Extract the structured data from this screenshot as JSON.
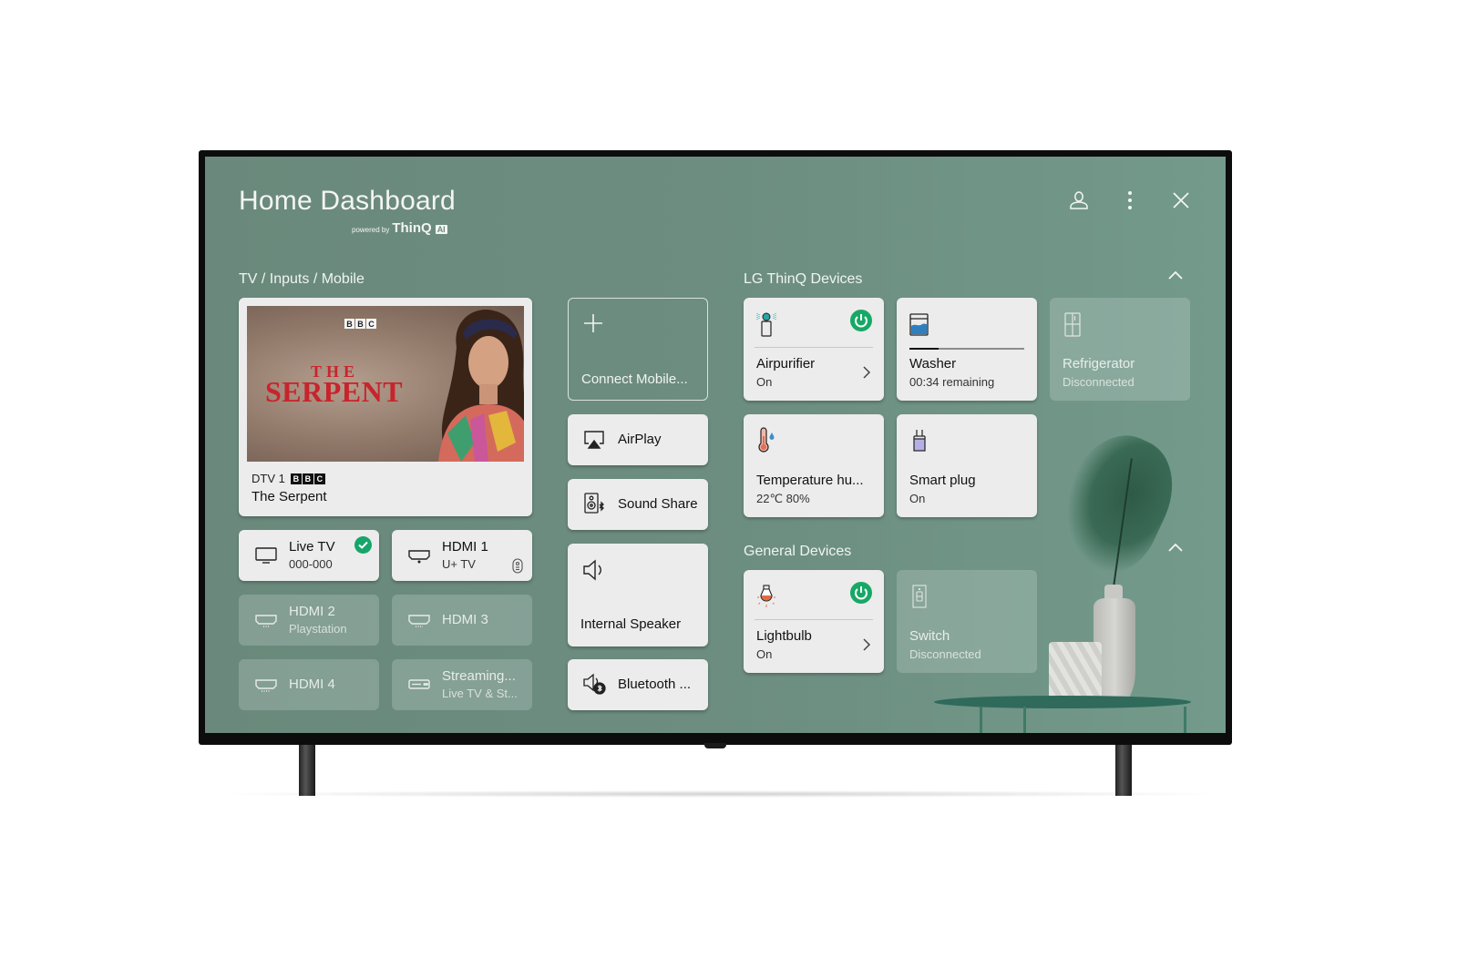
{
  "header": {
    "title": "Home Dashboard",
    "powered_by_prefix": "powered by",
    "powered_by_brand": "ThinQ",
    "powered_by_badge": "AI",
    "icons": [
      "user-icon",
      "more-vertical-icon",
      "close-icon"
    ]
  },
  "tv_inputs": {
    "section_label": "TV / Inputs / Mobile",
    "now_playing": {
      "channel": "DTV 1",
      "network_logo": "BBC",
      "program": "The Serpent",
      "poster_brand": "BBC",
      "poster_title_top": "THE",
      "poster_title_main": "SERPENT"
    },
    "inputs": [
      {
        "name": "Live TV",
        "sub": "000-000",
        "icon": "tv-icon",
        "active": true,
        "connected": true
      },
      {
        "name": "HDMI 1",
        "sub": "U+ TV",
        "icon": "hdmi-icon",
        "connected": true,
        "extra_icon": "remote-icon"
      },
      {
        "name": "HDMI 2",
        "sub": "Playstation",
        "icon": "hdmi-icon",
        "connected": false
      },
      {
        "name": "HDMI 3",
        "sub": "",
        "icon": "hdmi-icon",
        "connected": false
      },
      {
        "name": "HDMI 4",
        "sub": "",
        "icon": "hdmi-icon",
        "connected": false
      },
      {
        "name": "Streaming...",
        "sub": "Live TV & St...",
        "icon": "settop-box-icon",
        "connected": false
      }
    ]
  },
  "mobile": {
    "connect_label": "Connect Mobile...",
    "items": [
      {
        "label": "AirPlay",
        "icon": "airplay-icon"
      },
      {
        "label": "Sound Share",
        "icon": "sound-share-icon"
      },
      {
        "label": "Internal Speaker",
        "icon": "speaker-icon"
      },
      {
        "label": "Bluetooth ...",
        "icon": "bluetooth-speaker-icon"
      }
    ]
  },
  "thinq_devices": {
    "section_label": "LG ThinQ Devices",
    "devices": [
      {
        "name": "Airpurifier",
        "status": "On",
        "icon": "air-purifier-icon",
        "power": true,
        "connected": true
      },
      {
        "name": "Washer",
        "status": "00:34 remaining",
        "icon": "washer-icon",
        "progress": 0.25,
        "connected": true
      },
      {
        "name": "Refrigerator",
        "status": "Disconnected",
        "icon": "refrigerator-icon",
        "connected": false
      },
      {
        "name": "Temperature hu...",
        "status": "22℃ 80%",
        "icon": "thermometer-icon",
        "connected": true
      },
      {
        "name": "Smart plug",
        "status": "On",
        "icon": "smart-plug-icon",
        "connected": true
      }
    ]
  },
  "general_devices": {
    "section_label": "General Devices",
    "devices": [
      {
        "name": "Lightbulb",
        "status": "On",
        "icon": "lightbulb-icon",
        "power": true,
        "connected": true
      },
      {
        "name": "Switch",
        "status": "Disconnected",
        "icon": "switch-icon",
        "connected": false
      }
    ]
  },
  "colors": {
    "background": "#6a8b7d",
    "card": "#ececec",
    "power_green": "#17a866",
    "poster_title_red": "#c8242c"
  }
}
